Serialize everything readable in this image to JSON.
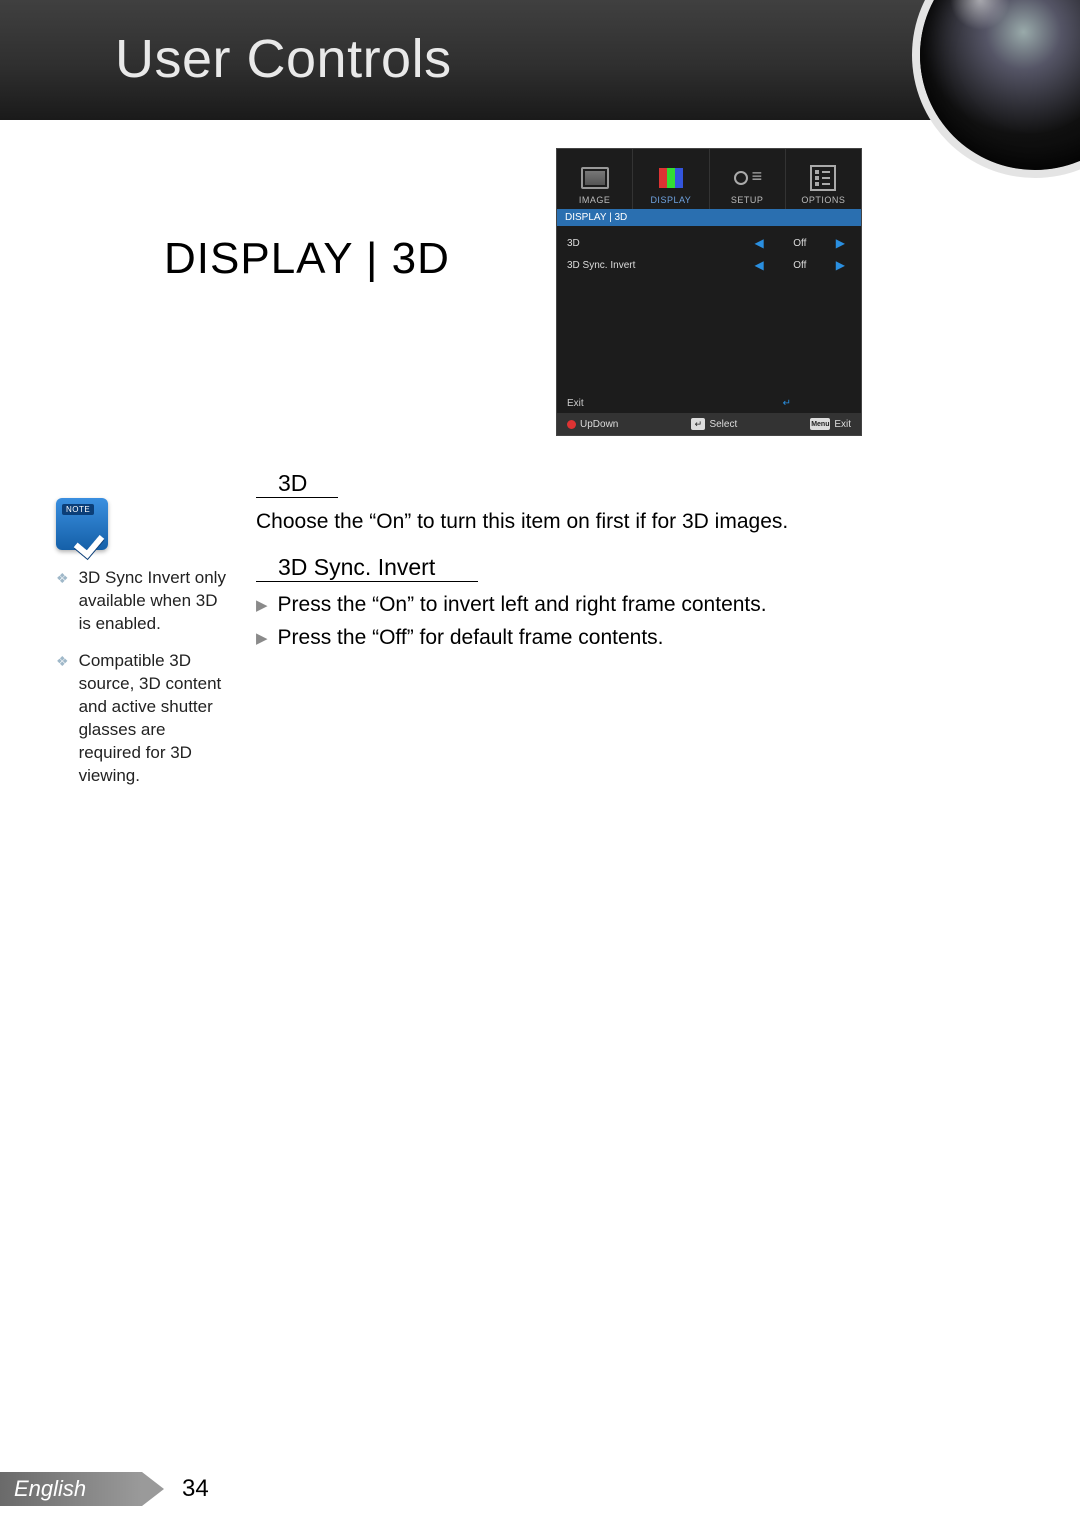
{
  "header": {
    "title": "User Controls"
  },
  "section_title": "DISPLAY | 3D",
  "osd": {
    "tabs": [
      {
        "label": "IMAGE"
      },
      {
        "label": "DISPLAY"
      },
      {
        "label": "SETUP"
      },
      {
        "label": "OPTIONS"
      }
    ],
    "breadcrumb": "DISPLAY  |  3D",
    "rows": [
      {
        "name": "3D",
        "value": "Off"
      },
      {
        "name": "3D Sync. Invert",
        "value": "Off"
      }
    ],
    "exit_label": "Exit",
    "footer": {
      "updown": "UpDown",
      "select": "Select",
      "exit": "Exit"
    }
  },
  "note_badge": {
    "label": "NOTE"
  },
  "side_notes": [
    "3D Sync Invert only available when 3D is enabled.",
    "Compatible 3D source, 3D content and active shutter glasses are required for 3D viewing."
  ],
  "body": {
    "s1_head": "3D",
    "s1_text": "Choose the “On” to turn this item on first if for 3D images.",
    "s2_head": "3D Sync. Invert",
    "s2_b1": "Press the “On” to invert left and right frame contents.",
    "s2_b2": "Press the “Off” for default frame contents."
  },
  "footer": {
    "language": "English",
    "page": "34"
  }
}
